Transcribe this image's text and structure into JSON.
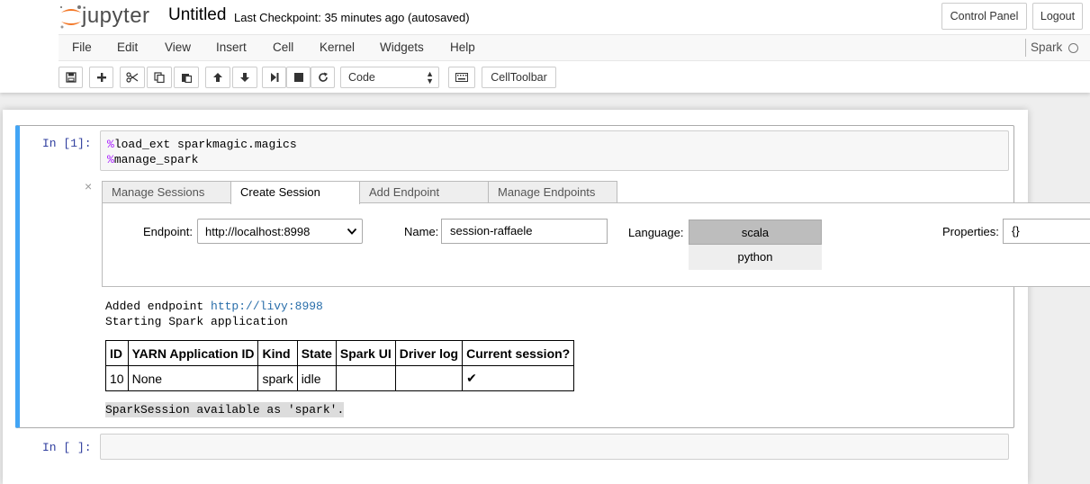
{
  "header": {
    "logo_text": "jupyter",
    "notebook_title": "Untitled",
    "checkpoint": "Last Checkpoint: 35 minutes ago (autosaved)",
    "control_panel_label": "Control Panel",
    "logout_label": "Logout"
  },
  "menu": {
    "items": [
      "File",
      "Edit",
      "View",
      "Insert",
      "Cell",
      "Kernel",
      "Widgets",
      "Help"
    ],
    "kernel_name": "Spark"
  },
  "toolbar": {
    "buttons": [
      "save-icon",
      "plus-icon",
      "scissors-icon",
      "copy-icon",
      "paste-icon",
      "arrow-up-icon",
      "arrow-down-icon",
      "run-icon",
      "stop-icon",
      "restart-icon",
      "keyboard-icon"
    ],
    "cell_type": "Code",
    "celltoolbar_label": "CellToolbar"
  },
  "cells": [
    {
      "prompt": "In [1]:",
      "code_lines": [
        {
          "pct": "%",
          "text": "load_ext sparkmagic.magics"
        },
        {
          "pct": "%",
          "text": "manage_spark"
        }
      ]
    },
    {
      "prompt": "In [ ]:"
    }
  ],
  "widget": {
    "close_symbol": "×",
    "tabs": [
      {
        "label": "Manage Sessions",
        "active": false
      },
      {
        "label": "Create Session",
        "active": true
      },
      {
        "label": "Add Endpoint",
        "active": false
      },
      {
        "label": "Manage Endpoints",
        "active": false
      }
    ],
    "endpoint_label": "Endpoint:",
    "endpoint_value": "http://localhost:8998",
    "name_label": "Name:",
    "name_value": "session-raffaele",
    "language_label": "Language:",
    "language_options": [
      "scala",
      "python"
    ],
    "language_selected": "scala",
    "properties_label": "Properties:",
    "properties_value": "{}"
  },
  "output": {
    "added_endpoint_prefix": "Added endpoint ",
    "added_endpoint_url": "http://livy:8998",
    "starting_text": "Starting Spark application",
    "table_headers": [
      "ID",
      "YARN Application ID",
      "Kind",
      "State",
      "Spark UI",
      "Driver log",
      "Current session?"
    ],
    "table_row": [
      "10",
      "None",
      "spark",
      "idle",
      "",
      "",
      "✔"
    ],
    "spark_available": "SparkSession available as 'spark'."
  },
  "colors": {
    "cell_selected_border": "#42a5f5",
    "prompt_color": "#303f9f",
    "magic_color": "#aa22ff",
    "link_color": "#296eaa"
  }
}
